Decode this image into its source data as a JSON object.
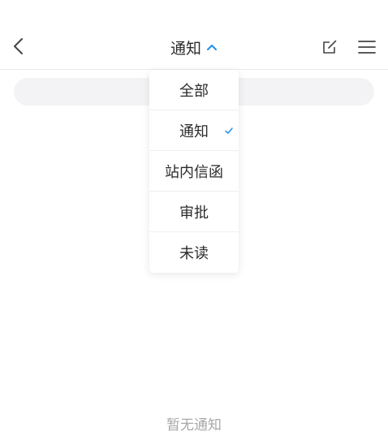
{
  "header": {
    "title": "通知",
    "back_icon": "chevron-left-icon",
    "title_toggle_icon": "chevron-up-icon",
    "edit_icon": "edit-icon",
    "menu_icon": "menu-icon",
    "accent_color": "#1e90f0"
  },
  "search": {
    "placeholder": ""
  },
  "filter_menu": {
    "selected": "通知",
    "items": [
      {
        "label": "全部"
      },
      {
        "label": "通知",
        "selected": true
      },
      {
        "label": "站内信函"
      },
      {
        "label": "审批"
      },
      {
        "label": "未读"
      }
    ]
  },
  "empty_state": {
    "text": "暂无通知"
  }
}
